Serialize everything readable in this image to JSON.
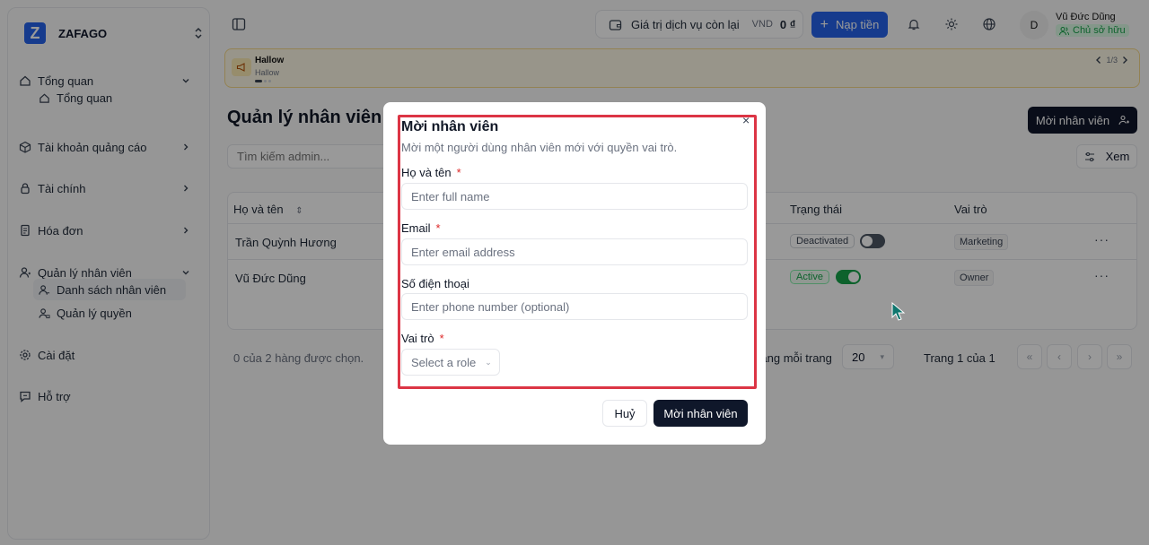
{
  "brand": {
    "logo": "Z",
    "name": "ZAFAGO"
  },
  "sidebar": {
    "items": [
      {
        "label": "Tổng quan",
        "icon": "home-icon"
      },
      {
        "label": "Tổng quan",
        "icon": "home-icon"
      },
      {
        "label": "Tài khoản quảng cáo",
        "icon": "box-icon"
      },
      {
        "label": "Tài chính",
        "icon": "wallet-icon"
      },
      {
        "label": "Hóa đơn",
        "icon": "receipt-icon"
      },
      {
        "label": "Quản lý nhân viên",
        "icon": "user-icon"
      },
      {
        "label": "Danh sách nhân viên",
        "icon": "user-list-icon"
      },
      {
        "label": "Quản lý quyền",
        "icon": "user-lock-icon"
      },
      {
        "label": "Cài đặt",
        "icon": "gear-icon"
      },
      {
        "label": "Hỗ trợ",
        "icon": "chat-icon"
      }
    ]
  },
  "topbar": {
    "balance_label": "Giá trị dịch vụ còn lại",
    "currency": "VND",
    "amount": "0 ₫",
    "topup_label": "Nạp tiền",
    "avatar_initial": "D",
    "user_name": "Vũ Đức Dũng",
    "user_role": "Chủ sở hữu"
  },
  "banner": {
    "title": "Hallow",
    "subtitle": "Hallow",
    "pager": "1/3"
  },
  "page": {
    "title": "Quản lý nhân viên",
    "invite_label": "Mời nhân viên",
    "search_placeholder": "Tìm kiếm admin...",
    "view_label": "Xem"
  },
  "table": {
    "headers": {
      "name": "Họ và tên",
      "status": "Trạng thái",
      "role": "Vai trò"
    },
    "rows": [
      {
        "name": "Trần Quỳnh Hương",
        "status": "Deactivated",
        "active": false,
        "role": "Marketing"
      },
      {
        "name": "Vũ Đức Dũng",
        "status": "Active",
        "active": true,
        "role": "Owner"
      }
    ],
    "more": "···"
  },
  "footer": {
    "selected_text": "0 của 2 hàng được chọn.",
    "rows_per_page_label": "Hàng mỗi trang",
    "rows_per_page": "20",
    "page_info": "Trang 1 của 1"
  },
  "modal": {
    "title": "Mời nhân viên",
    "description": "Mời một người dùng nhân viên mới với quyền vai trò.",
    "name_label": "Họ và tên",
    "name_placeholder": "Enter full name",
    "email_label": "Email",
    "email_placeholder": "Enter email address",
    "phone_label": "Số điện thoại",
    "phone_placeholder": "Enter phone number (optional)",
    "role_label": "Vai trò",
    "role_placeholder": "Select a role",
    "required_mark": "*",
    "close": "×",
    "cancel_label": "Huỷ",
    "submit_label": "Mời nhân viên"
  },
  "colors": {
    "accent": "#2563eb",
    "dark": "#0f172a",
    "highlight": "#dc3545",
    "success": "#16a34a"
  }
}
